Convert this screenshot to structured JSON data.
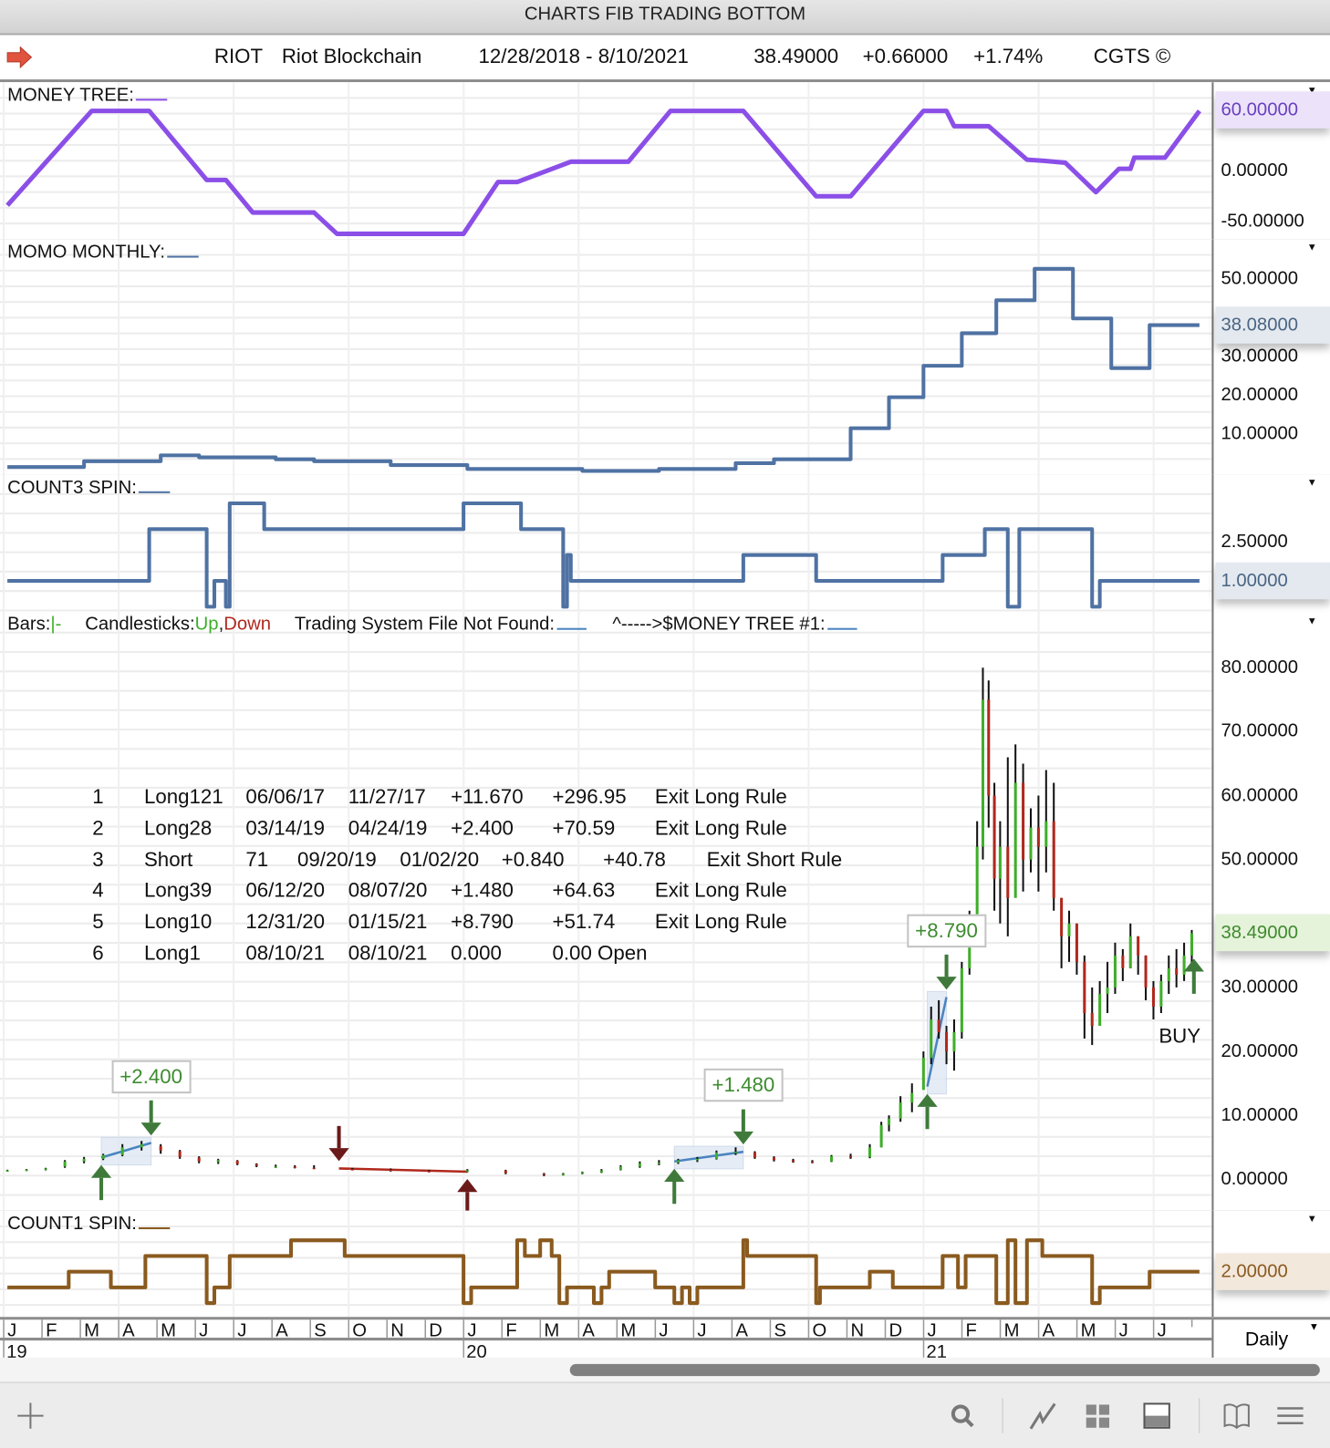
{
  "window": {
    "title": "CHARTS FIB TRADING BOTTOM"
  },
  "header": {
    "symbol": "RIOT",
    "name": "Riot Blockchain",
    "range": "12/28/2018 - 8/10/2021",
    "last": "38.49000",
    "change": "+0.66000",
    "change_pct": "+1.74%",
    "copyright": "CGTS ©",
    "arrow_icon": "red-right-arrow-icon"
  },
  "panels": {
    "money_tree": {
      "title": "MONEY TREE:",
      "color": "#8b4fe8",
      "axis_labels": [
        {
          "value": 0,
          "text": "0.00000"
        },
        {
          "value": -50,
          "text": "-50.00000"
        }
      ],
      "current": {
        "value": 60,
        "text": "60.00000",
        "bg": "#ece3fb",
        "fg": "#6b3fbf"
      }
    },
    "momo_monthly": {
      "title": "MOMO MONTHLY:",
      "color": "#4f72a3",
      "axis_labels": [
        {
          "value": 50,
          "text": "50.00000"
        },
        {
          "value": 30,
          "text": "30.00000"
        },
        {
          "value": 20,
          "text": "20.00000"
        },
        {
          "value": 10,
          "text": "10.00000"
        }
      ],
      "current": {
        "value": 38.08,
        "text": "38.08000",
        "bg": "#e4e9f0",
        "fg": "#4a6583"
      }
    },
    "count3_spin": {
      "title": "COUNT3 SPIN:",
      "color": "#4f72a3",
      "axis_labels": [
        {
          "value": 2.5,
          "text": "2.50000"
        }
      ],
      "current": {
        "value": 1,
        "text": "1.00000",
        "bg": "#e4e9f0",
        "fg": "#4a6583"
      }
    },
    "price": {
      "legend": {
        "bars": "Bars:",
        "bars_glyph": "|-",
        "candles": "Candlesticks:",
        "up": "Up",
        "comma": ",",
        "down": "Down",
        "system": "Trading System File Not Found:",
        "money_tree": "^----->$MONEY TREE #1:"
      },
      "colors": {
        "up": "#3fae2a",
        "down": "#b0281c",
        "wick": "#111111",
        "long": "#4a84c0",
        "short": "#b0281c",
        "arrow_long": "#3f7a3a",
        "arrow_short": "#6b1a1a"
      },
      "axis_labels": [
        {
          "value": 80,
          "text": "80.00000"
        },
        {
          "value": 70,
          "text": "70.00000"
        },
        {
          "value": 60,
          "text": "60.00000"
        },
        {
          "value": 50,
          "text": "50.00000"
        },
        {
          "value": 30,
          "text": "30.00000"
        },
        {
          "value": 20,
          "text": "20.00000"
        },
        {
          "value": 10,
          "text": "10.00000"
        },
        {
          "value": 0,
          "text": "0.00000"
        }
      ],
      "current": {
        "value": 38.49,
        "text": "38.49000",
        "bg": "#e5f3da",
        "fg": "#3f8a2e"
      },
      "buy_label": "BUY"
    },
    "count1_spin": {
      "title": "COUNT1 SPIN:",
      "color": "#8a5a1e",
      "axis_labels": [],
      "current": {
        "value": 2,
        "text": "2.00000",
        "bg": "#f3e8dc",
        "fg": "#8a5a20"
      }
    }
  },
  "trades_table": [
    [
      "1",
      "Long121",
      "06/06/17",
      "11/27/17",
      "+11.670",
      "+296.95",
      "Exit Long Rule"
    ],
    [
      "2",
      "Long28",
      "03/14/19",
      "04/24/19",
      "+2.400",
      "+70.59",
      "Exit Long Rule"
    ],
    [
      "3",
      "Short",
      "71",
      "09/20/19",
      "01/02/20",
      "+0.840",
      "+40.78",
      "Exit Short Rule"
    ],
    [
      "4",
      "Long39",
      "06/12/20",
      "08/07/20",
      "+1.480",
      "+64.63",
      "Exit Long Rule"
    ],
    [
      "5",
      "Long10",
      "12/31/20",
      "01/15/21",
      "+8.790",
      "+51.74",
      "Exit Long Rule"
    ],
    [
      "6",
      "Long1",
      "08/10/21",
      "08/10/21",
      "0.000",
      "0.00 Open"
    ]
  ],
  "chart_data": [
    {
      "type": "line",
      "title": "MONEY TREE",
      "x_unit": "months since Jan 2019",
      "ylim": [
        -65,
        65
      ],
      "x": [
        0,
        2.2,
        3.7,
        5.2,
        5.7,
        6.4,
        8.0,
        8.6,
        11.9,
        12.8,
        13.3,
        14.7,
        16.2,
        17.3,
        19.2,
        21.1,
        22.0,
        23.9,
        24.5,
        24.7,
        25.6,
        26.6,
        27.0,
        27.6,
        28.4,
        29.0,
        29.3,
        29.4,
        30.2,
        31.1
      ],
      "y": [
        -34,
        59,
        59,
        -9,
        -9,
        -41,
        -41,
        -62,
        -62,
        -11,
        -11,
        9,
        9,
        59,
        59,
        -25,
        -25,
        59,
        59,
        44,
        44,
        11,
        10,
        8,
        -21,
        2,
        2,
        13,
        13,
        59
      ]
    },
    {
      "type": "line",
      "title": "MOMO MONTHLY",
      "step": true,
      "x_unit": "months since Jan 2019",
      "ylim": [
        0,
        58
      ],
      "x": [
        0,
        2,
        4,
        5,
        7,
        8,
        10,
        12,
        15,
        17,
        19,
        20,
        22,
        23,
        23.9,
        24.9,
        25.8,
        26.8,
        27.8,
        28.8,
        29.8,
        31.1
      ],
      "y": [
        1.5,
        3,
        4.5,
        4,
        3.5,
        3,
        2,
        1,
        0.5,
        1,
        2.5,
        3.5,
        11.5,
        19.5,
        27.6,
        36,
        44.5,
        52.6,
        39.8,
        27,
        38.08,
        38.08
      ]
    },
    {
      "type": "line",
      "title": "COUNT3 SPIN",
      "step": true,
      "x_unit": "months since Jan 2019",
      "ylim": [
        -0.3,
        4.6
      ],
      "x": [
        0,
        3.7,
        5.2,
        5.4,
        5.7,
        5.8,
        6.7,
        11.9,
        13.4,
        14.5,
        14.6,
        14.7,
        19.2,
        21.1,
        24.4,
        25.5,
        26.1,
        26.4,
        28.3,
        28.5,
        31.1
      ],
      "y": [
        1,
        3,
        0,
        1,
        0,
        4,
        3,
        4,
        3,
        0,
        2,
        1,
        2,
        1,
        2,
        3,
        0,
        3,
        0,
        1,
        1
      ]
    },
    {
      "type": "bar",
      "title": "RIOT Daily Candlesticks",
      "x_unit": "months since Jan 2019",
      "ylim": [
        0,
        82
      ],
      "columns": [
        "month",
        "open",
        "high",
        "low",
        "close"
      ],
      "ohlc": [
        [
          0.0,
          1.3,
          1.5,
          1.2,
          1.4
        ],
        [
          0.5,
          1.4,
          1.6,
          1.3,
          1.5
        ],
        [
          1.0,
          1.5,
          1.8,
          1.4,
          1.7
        ],
        [
          1.5,
          2.0,
          3.0,
          1.8,
          2.8
        ],
        [
          2.0,
          2.8,
          3.5,
          2.5,
          3.2
        ],
        [
          2.5,
          3.2,
          4.0,
          3.0,
          3.8
        ],
        [
          3.0,
          3.8,
          5.5,
          3.6,
          5.0
        ],
        [
          3.5,
          5.0,
          6.0,
          4.5,
          5.5
        ],
        [
          4.0,
          5.2,
          5.5,
          4.0,
          4.5
        ],
        [
          4.5,
          4.4,
          4.6,
          3.2,
          3.5
        ],
        [
          5.0,
          3.4,
          3.6,
          2.5,
          2.8
        ],
        [
          5.5,
          2.7,
          3.2,
          2.4,
          3.0
        ],
        [
          6.0,
          2.9,
          3.0,
          2.2,
          2.4
        ],
        [
          6.5,
          2.4,
          2.5,
          1.9,
          2.1
        ],
        [
          7.0,
          2.0,
          2.3,
          1.8,
          2.0
        ],
        [
          7.5,
          2.0,
          2.2,
          1.7,
          1.8
        ],
        [
          8,
          1.8,
          2.2,
          1.6,
          1.7
        ],
        [
          9,
          1.6,
          1.8,
          1.4,
          1.5
        ],
        [
          10,
          1.5,
          1.7,
          1.2,
          1.3
        ],
        [
          11,
          1.3,
          1.5,
          1.1,
          1.2
        ],
        [
          12,
          1.2,
          1.6,
          1.1,
          1.4
        ],
        [
          13,
          1.4,
          1.5,
          0.8,
          1.0
        ],
        [
          14,
          0.9,
          1.0,
          0.5,
          0.7
        ],
        [
          14.5,
          0.7,
          1.0,
          0.6,
          0.9
        ],
        [
          15,
          0.9,
          1.2,
          0.8,
          1.1
        ],
        [
          15.5,
          1.1,
          1.6,
          1.0,
          1.4
        ],
        [
          16,
          1.5,
          2.2,
          1.4,
          2.0
        ],
        [
          16.5,
          2.0,
          2.8,
          1.8,
          2.5
        ],
        [
          17,
          2.4,
          3.0,
          2.2,
          2.6
        ],
        [
          17.5,
          2.6,
          3.2,
          2.4,
          3.0
        ],
        [
          18,
          3.0,
          3.5,
          2.7,
          3.2
        ],
        [
          18.5,
          3.2,
          4.5,
          3.1,
          4.2
        ],
        [
          19,
          4.2,
          5.0,
          3.8,
          4.3
        ],
        [
          19.5,
          4.2,
          4.4,
          3.2,
          3.4
        ],
        [
          20,
          3.4,
          3.6,
          2.8,
          3.0
        ],
        [
          20.5,
          3.0,
          3.2,
          2.6,
          2.8
        ],
        [
          21,
          2.8,
          3.0,
          2.5,
          2.7
        ],
        [
          21.5,
          2.8,
          3.8,
          2.7,
          3.6
        ],
        [
          22,
          3.6,
          4.0,
          3.2,
          3.5
        ],
        [
          22.5,
          3.5,
          5.5,
          3.3,
          5.0
        ],
        [
          22.8,
          5,
          9,
          5,
          8.5
        ],
        [
          23.0,
          8.5,
          10,
          7.5,
          9.5
        ],
        [
          23.3,
          9.5,
          13,
          9,
          12
        ],
        [
          23.6,
          12,
          15,
          10.5,
          13.5
        ],
        [
          23.9,
          14,
          20,
          14,
          19
        ],
        [
          24.1,
          19,
          27,
          18,
          25
        ],
        [
          24.3,
          25,
          28,
          22,
          23
        ],
        [
          24.5,
          23,
          24,
          18,
          20
        ],
        [
          24.7,
          20,
          25,
          17,
          23
        ],
        [
          24.9,
          23,
          34,
          22,
          33
        ],
        [
          25.1,
          33,
          42,
          32,
          40
        ],
        [
          25.3,
          40,
          56,
          38,
          52
        ],
        [
          25.45,
          52,
          80,
          50,
          75
        ],
        [
          25.6,
          75,
          78,
          55,
          60
        ],
        [
          25.75,
          60,
          62,
          42,
          47
        ],
        [
          25.9,
          47,
          56,
          40,
          52
        ],
        [
          26.1,
          52,
          66,
          38,
          44
        ],
        [
          26.3,
          44,
          68,
          48,
          62
        ],
        [
          26.5,
          62,
          65,
          45,
          50
        ],
        [
          26.7,
          50,
          58,
          48,
          55
        ],
        [
          26.9,
          55,
          60,
          45,
          52
        ],
        [
          27.1,
          52,
          64,
          48,
          56
        ],
        [
          27.3,
          56,
          62,
          42,
          44
        ],
        [
          27.5,
          44,
          44,
          33,
          38
        ],
        [
          27.7,
          38,
          42,
          34,
          40
        ],
        [
          27.9,
          40,
          40,
          32,
          34
        ],
        [
          28.1,
          34,
          35,
          22,
          26
        ],
        [
          28.3,
          26,
          30,
          21,
          24
        ],
        [
          28.5,
          24,
          31,
          24,
          29
        ],
        [
          28.7,
          29,
          34,
          26,
          30
        ],
        [
          28.9,
          30,
          37,
          29,
          35
        ],
        [
          29.1,
          35,
          36,
          31,
          33
        ],
        [
          29.3,
          33,
          40,
          33,
          38
        ],
        [
          29.5,
          38,
          38,
          32,
          35
        ],
        [
          29.7,
          35,
          35,
          28,
          30
        ],
        [
          29.9,
          30,
          31,
          25,
          27
        ],
        [
          30.1,
          27,
          32,
          26,
          31
        ],
        [
          30.3,
          31,
          35,
          29,
          33
        ],
        [
          30.5,
          33,
          36,
          30,
          32
        ],
        [
          30.7,
          32,
          37,
          31,
          35
        ],
        [
          30.9,
          35,
          39,
          33,
          38.49
        ]
      ],
      "trades": [
        {
          "side": "long",
          "entry_month": 2.45,
          "exit_month": 3.75,
          "entry_price": 3.4,
          "exit_price": 5.7,
          "label": "+2.400"
        },
        {
          "side": "short",
          "entry_month": 8.65,
          "exit_month": 12.0,
          "entry_price": 1.7,
          "exit_price": 1.2,
          "label": ""
        },
        {
          "side": "long",
          "entry_month": 17.4,
          "exit_month": 19.2,
          "entry_price": 2.8,
          "exit_price": 4.3,
          "label": "+1.480"
        },
        {
          "side": "long",
          "entry_month": 24.0,
          "exit_month": 24.5,
          "entry_price": 14.5,
          "exit_price": 28.5,
          "label": "+8.790"
        },
        {
          "side": "open",
          "entry_month": 31.1,
          "entry_price": 34.5,
          "label": ""
        }
      ]
    },
    {
      "type": "line",
      "title": "COUNT1 SPIN",
      "step": true,
      "x_unit": "months since Jan 2019",
      "ylim": [
        -0.3,
        4.6
      ],
      "x": [
        0,
        1.6,
        2.7,
        3.6,
        5.2,
        5.4,
        5.8,
        7.4,
        8.8,
        11.9,
        12.1,
        13.3,
        13.5,
        13.9,
        14.2,
        14.4,
        14.6,
        15.3,
        15.5,
        15.7,
        16.9,
        17.4,
        17.6,
        17.8,
        18.0,
        18.2,
        19.2,
        19.3,
        21.1,
        21.2,
        22.5,
        23.1,
        24.4,
        24.8,
        25.0,
        25.6,
        25.8,
        26.1,
        26.3,
        26.6,
        27.0,
        28.3,
        28.5,
        29.0,
        29.8,
        31.1
      ],
      "y": [
        1,
        2,
        1,
        3,
        0,
        1,
        3,
        4,
        3,
        0,
        1,
        4,
        3,
        4,
        3,
        0,
        1,
        0,
        1,
        2,
        1,
        0,
        1,
        0,
        1,
        1,
        4,
        3,
        0,
        1,
        2,
        1,
        3,
        1,
        3,
        3,
        0,
        4,
        0,
        4,
        3,
        0,
        1,
        1,
        2,
        2
      ]
    }
  ],
  "date_axis": {
    "months": [
      "J",
      "F",
      "M",
      "A",
      "M",
      "J",
      "J",
      "A",
      "S",
      "O",
      "N",
      "D",
      "J",
      "F",
      "M",
      "A",
      "M",
      "J",
      "J",
      "A",
      "S",
      "O",
      "N",
      "D",
      "J",
      "F",
      "M",
      "A",
      "M",
      "J",
      "J"
    ],
    "years": [
      {
        "label": "19",
        "month": 0
      },
      {
        "label": "20",
        "month": 12
      },
      {
        "label": "21",
        "month": 24
      }
    ],
    "interval": "Daily"
  },
  "toolbar": {
    "icons": [
      "plus-icon",
      "search-icon",
      "line-chart-icon",
      "grid-icon",
      "panel-icon",
      "book-icon",
      "menu-icon"
    ]
  }
}
